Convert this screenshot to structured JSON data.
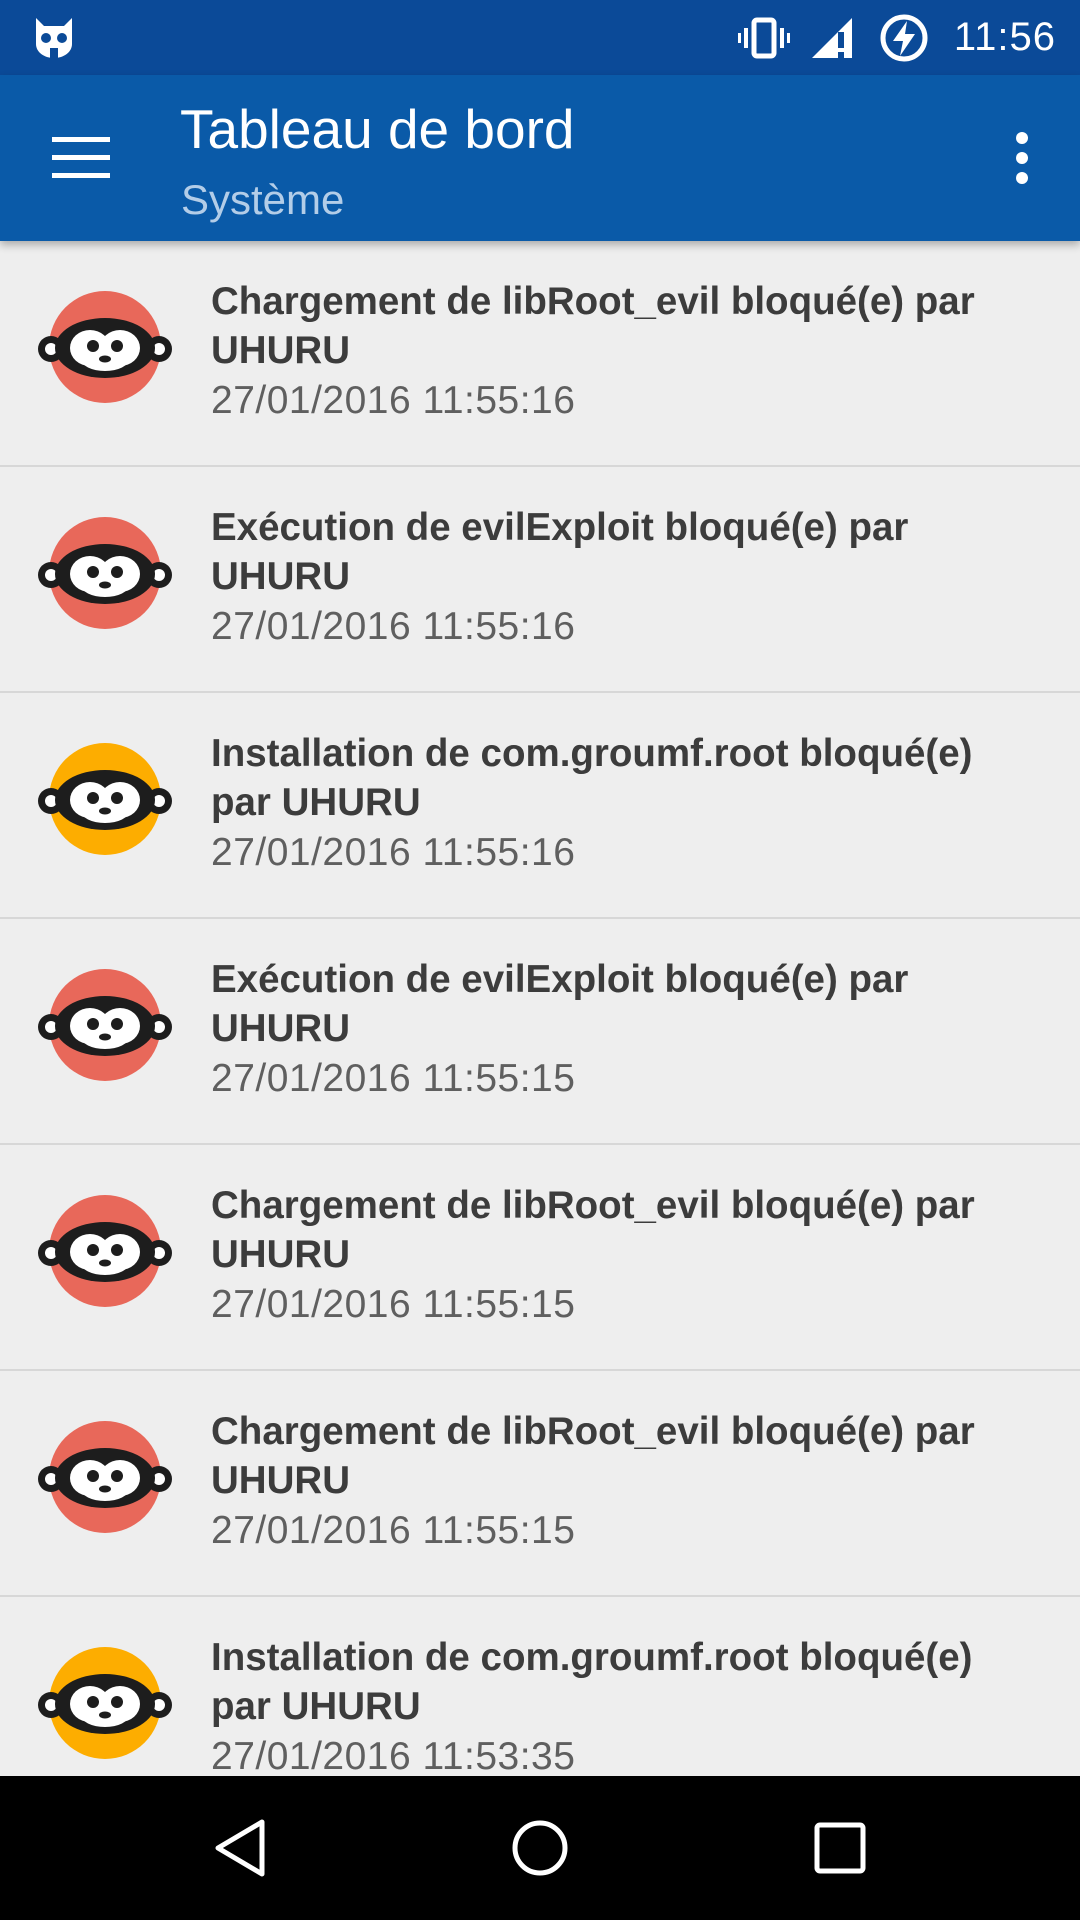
{
  "status_bar": {
    "time": "11:56",
    "icons": [
      "cat-notification-icon",
      "vibrate-icon",
      "signal-icon",
      "battery-charging-icon"
    ]
  },
  "app_bar": {
    "title": "Tableau de bord",
    "subtitle": "Système",
    "icons": [
      "hamburger-menu-icon",
      "overflow-menu-icon"
    ]
  },
  "colors": {
    "status_bar": "#0b4a98",
    "app_bar": "#0a5aa8",
    "avatar_red": "#e8685a",
    "avatar_orange": "#fdad00",
    "background": "#eeeeee"
  },
  "events": [
    {
      "title": "Chargement de libRoot_evil bloqué(e) par UHURU",
      "date": "27/01/2016 11:55:16",
      "severity": "red"
    },
    {
      "title": "Exécution de evilExploit bloqué(e) par UHURU",
      "date": "27/01/2016 11:55:16",
      "severity": "red"
    },
    {
      "title": "Installation de com.groumf.root bloqué(e) par UHURU",
      "date": "27/01/2016 11:55:16",
      "severity": "orange"
    },
    {
      "title": "Exécution de evilExploit bloqué(e) par UHURU",
      "date": "27/01/2016 11:55:15",
      "severity": "red"
    },
    {
      "title": "Chargement de libRoot_evil bloqué(e) par UHURU",
      "date": "27/01/2016 11:55:15",
      "severity": "red"
    },
    {
      "title": "Chargement de libRoot_evil bloqué(e) par UHURU",
      "date": "27/01/2016 11:55:15",
      "severity": "red"
    },
    {
      "title": "Installation de com.groumf.root bloqué(e) par UHURU",
      "date": "27/01/2016 11:53:35",
      "severity": "orange"
    }
  ],
  "nav_bar": {
    "icons": [
      "back-icon",
      "home-icon",
      "recents-icon"
    ]
  }
}
